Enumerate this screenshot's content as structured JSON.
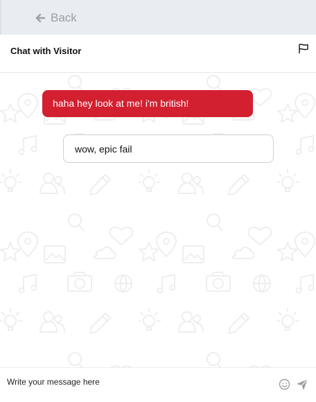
{
  "topbar": {
    "back_label": "Back"
  },
  "header": {
    "title": "Chat with Visitor"
  },
  "messages": [
    {
      "text": "haha hey look at me! i'm british!",
      "style": "visitor",
      "color": "#d22030"
    },
    {
      "text": "wow, epic fail",
      "style": "operator"
    }
  ],
  "composer": {
    "placeholder": "Write your message here",
    "value": ""
  },
  "icons": {
    "back": "arrow-left-icon",
    "flag": "flag-icon",
    "emoji": "smiley-icon",
    "send": "paper-plane-icon"
  },
  "colors": {
    "topbar_bg": "#e9ecf0",
    "accent": "#d22030",
    "muted": "#9aa0a6"
  }
}
